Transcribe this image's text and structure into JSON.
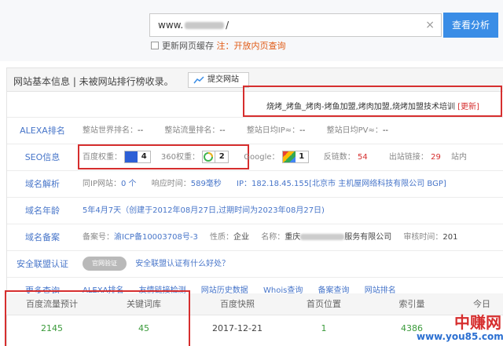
{
  "search": {
    "url_prefix": "www.",
    "url_suffix": "/",
    "submit_label": "查看分析",
    "refresh_label": "更新网页缓存",
    "refresh_note": "注：开放内页查询"
  },
  "panel": {
    "title": "网站基本信息 | 未被网站排行榜收录。",
    "submit_site_label": "提交网站"
  },
  "keywords": {
    "text": "烧烤_烤鱼_烤肉-烤鱼加盟,烤肉加盟,烧烤加盟技术培训",
    "update_label": "[更新]"
  },
  "rows": {
    "alexa": {
      "label": "ALEXA排名",
      "world_label": "整站世界排名：",
      "world_val": "--",
      "flow_label": "整站流量排名：",
      "flow_val": "--",
      "ip_label": "整站日均IP≈：",
      "ip_val": "--",
      "pv_label": "整站日均PV≈：",
      "pv_val": "--"
    },
    "seo": {
      "label": "SEO信息",
      "baidu_label": "百度权重：",
      "baidu_val": "4",
      "s360_label": "360权重：",
      "s360_val": "2",
      "google_label": "Google：",
      "google_val": "1",
      "backlinks_label": "反链数：",
      "backlinks_val": "54",
      "outlinks_label": "出站链接：",
      "outlinks_val": "29",
      "inlinks_label": "站内"
    },
    "resolve": {
      "label": "域名解析",
      "sameip_label": "同IP网站：",
      "sameip_val": "0 个",
      "speed_label": "响应时间：",
      "speed_val": "589毫秒",
      "ip_text": "IP：182.18.45.155[北京市 主机屋网络科技有限公司 BGP]"
    },
    "age": {
      "label": "域名年龄",
      "text": "5年4月7天（创建于2012年08月27日,过期时间为2023年08月27日)"
    },
    "icp": {
      "label": "域名备案",
      "num_label": "备案号：",
      "num_val": "渝ICP备10003708号-3",
      "nature_label": "性质：",
      "nature_val": "企业",
      "name_label": "名称：",
      "name_prefix": "重庆",
      "name_suffix": "服务有限公司",
      "time_label": "审核时间：",
      "time_val": "201"
    },
    "security": {
      "label": "安全联盟认证",
      "seal_text": "官网验证",
      "link": "安全联盟认证有什么好处？"
    },
    "more": {
      "label": "更多查询",
      "links": [
        "ALEXA排名",
        "友情链接检测",
        "网站历史数据",
        "Whois查询",
        "备案查询",
        "网站排名"
      ]
    }
  },
  "stats": {
    "headers": [
      "百度流量预计",
      "关键词库",
      "百度快照",
      "首页位置",
      "索引量",
      "今日"
    ],
    "values": [
      "2145",
      "45",
      "2017-12-21",
      "1",
      "4386",
      ""
    ]
  },
  "watermark": {
    "cn": "中赚网",
    "url": "www.you85.com"
  }
}
